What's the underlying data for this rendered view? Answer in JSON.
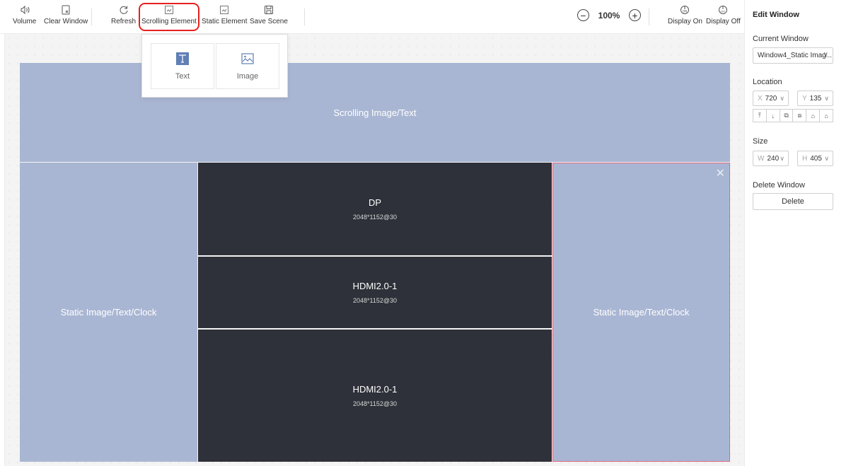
{
  "toolbar": {
    "volume": "Volume",
    "clear_window": "Clear Window",
    "refresh": "Refresh",
    "scrolling_element": "Scrolling Element",
    "static_element": "Static Element",
    "save_scene": "Save Scene",
    "zoom_level": "100%",
    "display_on": "Display On",
    "display_off": "Display Off"
  },
  "popover": {
    "text": "Text",
    "image": "Image"
  },
  "windows": {
    "scrolling": {
      "title": "Scrolling Image/Text"
    },
    "left_static": {
      "title": "Static Image/Text/Clock"
    },
    "dp": {
      "title": "DP",
      "resolution": "2048*1152@30"
    },
    "hdmi_a": {
      "title": "HDMI2.0-1",
      "resolution": "2048*1152@30"
    },
    "hdmi_b": {
      "title": "HDMI2.0-1",
      "resolution": "2048*1152@30"
    },
    "right_static": {
      "title": "Static Image/Text/Clock"
    }
  },
  "panel": {
    "title": "Edit Window",
    "current_window_label": "Current Window",
    "current_window_value": "Window4_Static Imag...",
    "location_label": "Location",
    "x_prefix": "X",
    "x_value": "720",
    "y_prefix": "Y",
    "y_value": "135",
    "size_label": "Size",
    "w_prefix": "W",
    "w_value": "240",
    "h_prefix": "H",
    "h_value": "405",
    "delete_label": "Delete Window",
    "delete_button": "Delete"
  },
  "colors": {
    "window_light": "#a9b6d3",
    "window_dark": "#2e3139",
    "highlight": "#e6201c",
    "selected_border": "#e06880"
  },
  "icons": [
    "volume-icon",
    "clear-window-icon",
    "refresh-icon",
    "scrolling-element-icon",
    "static-element-icon",
    "save-scene-icon",
    "zoom-out-icon",
    "zoom-in-icon",
    "display-on-icon",
    "display-off-icon",
    "text-icon",
    "image-icon",
    "chevron-down-icon",
    "close-icon",
    "chevron-right-icon"
  ]
}
